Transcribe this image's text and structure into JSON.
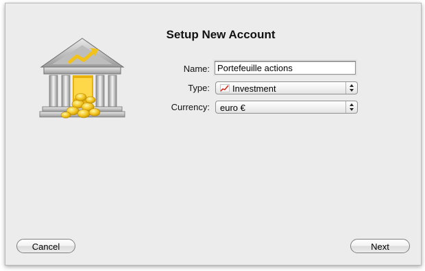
{
  "dialog": {
    "title": "Setup New Account"
  },
  "form": {
    "name_label": "Name:",
    "name_value": "Portefeuille actions",
    "type_label": "Type:",
    "type_value": "Investment",
    "type_icon": "investment-chart-icon",
    "currency_label": "Currency:",
    "currency_value": "euro €"
  },
  "buttons": {
    "cancel_label": "Cancel",
    "next_label": "Next"
  },
  "colors": {
    "window_bg": "#ececec",
    "gold": "#f2c21b",
    "chart_red": "#d22a1e"
  }
}
